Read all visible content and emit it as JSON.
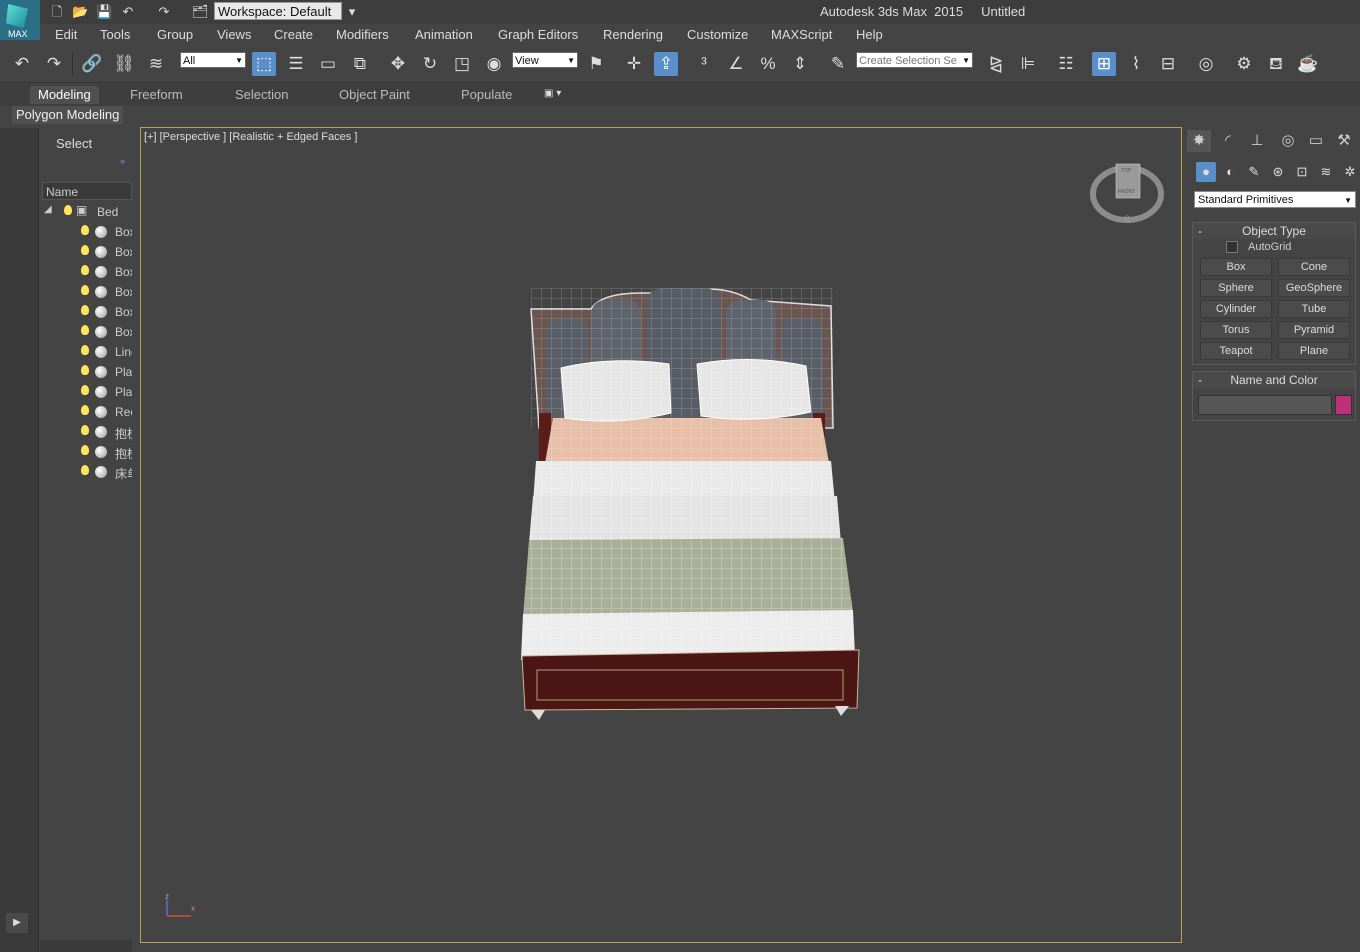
{
  "app": {
    "logo_text": "MAX",
    "title": "Autodesk 3ds Max  2015",
    "document": "Untitled"
  },
  "workspace": {
    "label": "Workspace: Default"
  },
  "menu": [
    "Edit",
    "Tools",
    "Group",
    "Views",
    "Create",
    "Modifiers",
    "Animation",
    "Graph Editors",
    "Rendering",
    "Customize",
    "MAXScript",
    "Help"
  ],
  "toolbar": {
    "selection_filter": "All",
    "ref_coord": "View",
    "named_selection_placeholder": "Create Selection Se"
  },
  "ribbon": {
    "tabs": [
      "Modeling",
      "Freeform",
      "Selection",
      "Object Paint",
      "Populate"
    ],
    "active": "Modeling",
    "panel_label": "Polygon Modeling"
  },
  "scene_explorer": {
    "select_label": "Select",
    "column": "Name",
    "root": "Bed",
    "items": [
      "Box",
      "Box",
      "Box",
      "Box",
      "Box",
      "Box",
      "Line",
      "Plan",
      "Plan",
      "Rec",
      "抱枕",
      "抱枕",
      "床单"
    ]
  },
  "viewport": {
    "label": "[+] [Perspective ] [Realistic + Edged Faces ]",
    "viewcube_top": "TOP",
    "viewcube_front": "FRONT",
    "viewcube_s": "S",
    "axis_z": "z",
    "axis_x": "x"
  },
  "command_panel": {
    "category": "Standard Primitives",
    "object_type": {
      "title": "Object Type",
      "autogrid": "AutoGrid",
      "buttons": [
        "Box",
        "Cone",
        "Sphere",
        "GeoSphere",
        "Cylinder",
        "Tube",
        "Torus",
        "Pyramid",
        "Teapot",
        "Plane"
      ]
    },
    "name_color": {
      "title": "Name and Color",
      "name_value": "",
      "color": "#c0307a"
    }
  },
  "colors": {
    "viewport_border": "#b7a35a",
    "selected_tool": "#5b8fc9"
  }
}
